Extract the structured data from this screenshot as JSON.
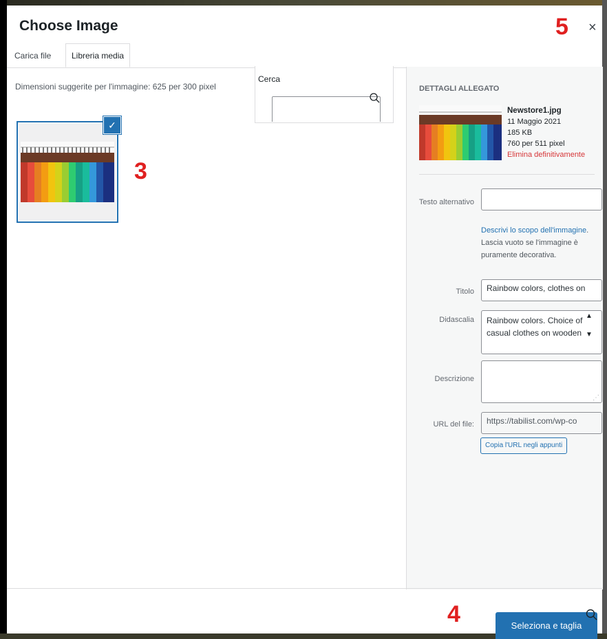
{
  "dialog": {
    "title": "Choose Image",
    "close_glyph": "×"
  },
  "tabs": [
    {
      "label": "Carica file",
      "active": false
    },
    {
      "label": "Libreria media",
      "active": true
    }
  ],
  "browser": {
    "suggested_size": "Dimensioni suggerite per l'immagine: 625 per 300 pixel",
    "search_label": "Cerca",
    "search_value": ""
  },
  "annotations": {
    "marker_3": "3",
    "marker_4": "4",
    "marker_5": "5"
  },
  "attachment": {
    "heading": "DETTAGLI ALLEGATO",
    "filename": "Newstore1.jpg",
    "date": "11 Maggio 2021",
    "size": "185 KB",
    "dimensions": "760 per 511 pixel",
    "delete_label": "Elimina definitivamente"
  },
  "fields": {
    "alt_label": "Testo alternativo",
    "alt_value": "",
    "alt_help_link": "Descrivi lo scopo dell'immagine",
    "alt_help_text": ". Lascia vuoto se l'immagine è puramente decorativa.",
    "title_label": "Titolo",
    "title_value": "Rainbow colors, clothes on",
    "caption_label": "Didascalia",
    "caption_value": "Rainbow colors. Choice of casual clothes on wooden",
    "description_label": "Descrizione",
    "description_value": "",
    "url_label": "URL del file:",
    "url_value": "https://tabilist.com/wp-co",
    "copy_url_button": "Copia l'URL negli appunti"
  },
  "footer": {
    "select_button": "Seleziona e taglia"
  },
  "icons": {
    "search": "magnifier-icon",
    "check": "checkmark-icon",
    "close": "close-icon"
  },
  "colors": {
    "accent": "#2271b1",
    "delete": "#d63638",
    "marker": "#e02020"
  }
}
